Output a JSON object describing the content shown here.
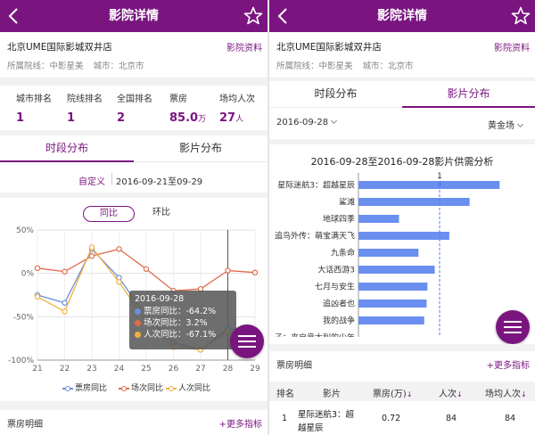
{
  "left": {
    "header": {
      "title": "影院详情"
    },
    "cinema": {
      "name": "北京UME国际影城双井店",
      "info_link": "影院资料",
      "chain_label": "所属院线：中影星美",
      "city_label": "城市：北京市"
    },
    "stats": [
      {
        "label": "城市排名",
        "value": "1",
        "unit": ""
      },
      {
        "label": "院线排名",
        "value": "1",
        "unit": ""
      },
      {
        "label": "全国排名",
        "value": "2",
        "unit": ""
      },
      {
        "label": "票房",
        "value": "85.0",
        "unit": "万"
      },
      {
        "label": "场均人次",
        "value": "27",
        "unit": "人"
      }
    ],
    "tabs": [
      "时段分布",
      "影片分布"
    ],
    "date_filter": {
      "custom": "自定义",
      "range": "2016-09-21至09-29"
    },
    "toggles": [
      "同比",
      "环比"
    ],
    "tooltip": {
      "date": "2016-09-28",
      "rows": [
        "票房同比：-64.2%",
        "场次同比：3.2%",
        "人次同比：-67.1%"
      ]
    },
    "box_office": {
      "heading": "票房明细",
      "more": "+更多指标"
    }
  },
  "right": {
    "header": {
      "title": "影院详情"
    },
    "cinema": {
      "name": "北京UME国际影城双井店",
      "info_link": "影院资料",
      "chain_label": "所属院线：中影星美",
      "city_label": "城市：北京市"
    },
    "tabs": [
      "时段分布",
      "影片分布"
    ],
    "date": "2016-09-28",
    "hall": "黄金场",
    "chart_title": "2016-09-28至2016-09-28影片供需分析",
    "box_office": {
      "heading": "票房明细",
      "more": "+更多指标"
    },
    "table": {
      "headers": [
        "排名",
        "影片",
        "票房(万)",
        "人次",
        "场均人次"
      ],
      "row": {
        "rank": "1",
        "movie_line1": "星际迷航3：超",
        "movie_line2": "越星辰",
        "box": "0.72",
        "admissions": "84",
        "avg": "84"
      }
    }
  },
  "chart_data": [
    {
      "type": "line",
      "title": "",
      "x": [
        "21",
        "22",
        "23",
        "24",
        "25",
        "26",
        "27",
        "28",
        "29"
      ],
      "ylim": [
        -100,
        50
      ],
      "yticks": [
        "50%",
        "0%",
        "-50%",
        "-100%"
      ],
      "grid": true,
      "legend_position": "bottom",
      "selected_x": "28",
      "series": [
        {
          "name": "票房同比",
          "color": "#6a8fd8",
          "values": [
            -25,
            -34,
            28,
            -5,
            -50,
            -80,
            -88,
            -64.2,
            -65
          ]
        },
        {
          "name": "场次同比",
          "color": "#e06c4a",
          "values": [
            6,
            2,
            20,
            28,
            5,
            -20,
            -18,
            3.2,
            1
          ]
        },
        {
          "name": "人次同比",
          "color": "#f0b040",
          "values": [
            -27,
            -44,
            30,
            -10,
            -55,
            -85,
            -88,
            -67.1,
            -68
          ]
        }
      ]
    },
    {
      "type": "bar",
      "orientation": "horizontal",
      "title": "2016-09-28至2016-09-28影片供需分析",
      "categories": [
        "星际迷航3：超越星辰",
        "鲨滩",
        "地球四季",
        "追鸟外传：萌宝满天飞",
        "九条命",
        "大话西游3",
        "七月与安生",
        "追凶者也",
        "我的战争",
        "…子：来自意大利的少年"
      ],
      "values": [
        1.74,
        1.37,
        0.5,
        1.12,
        0.74,
        0.94,
        0.85,
        0.84,
        0.81,
        0.0
      ],
      "xlim": [
        0,
        2
      ],
      "xticks": [
        "0",
        "1"
      ],
      "reference_line": 1,
      "reference_label": "1",
      "color": "#6a8fef"
    }
  ]
}
